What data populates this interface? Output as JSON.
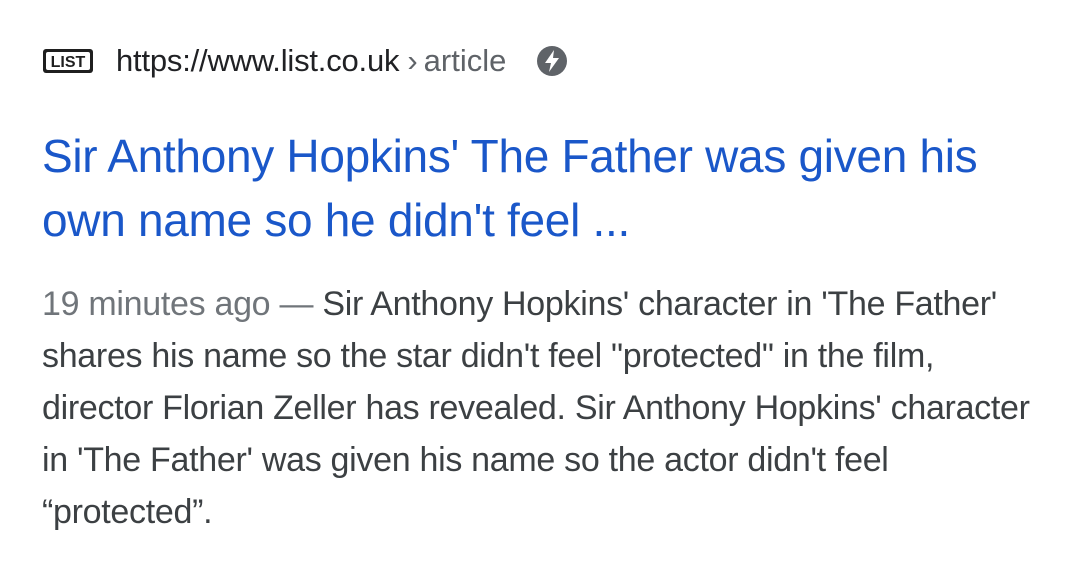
{
  "result": {
    "site_logo_text": "LIST",
    "url": "https://www.list.co.uk",
    "url_separator": "›",
    "url_path": "article",
    "amp_icon": "lightning-bolt-icon",
    "title": "Sir Anthony Hopkins' The Father was given his own name so he didn't feel ...",
    "snippet": {
      "date": "19 minutes ago",
      "dash": "—",
      "text": "Sir Anthony Hopkins' character in 'The Father' shares his name so the star didn't feel \"protected\" in the film, director Florian Zeller has revealed. Sir Anthony Hopkins' character in 'The Father' was given his name so the actor didn't feel “protected”."
    }
  },
  "colors": {
    "title_link": "#1a57c9",
    "url_text": "#202124",
    "secondary_text": "#5f6368",
    "snippet_text": "#3c4043",
    "amp_badge": "#5f6368"
  }
}
